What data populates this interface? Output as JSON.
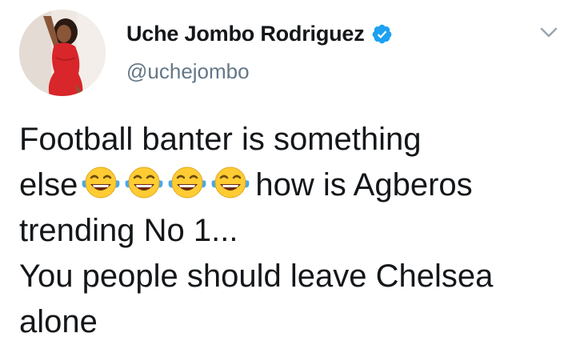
{
  "author": {
    "display_name": "Uche Jombo Rodriguez",
    "handle": "@uchejombo",
    "verified": true
  },
  "tweet": {
    "line1": "Football banter is something",
    "line2_before": "else",
    "line2_after": "how is Agberos",
    "line3": "trending No 1...",
    "line4": "You people should leave Chelsea",
    "line5": "alone",
    "emojis": [
      "face-with-tears-of-joy-icon",
      "face-with-tears-of-joy-icon",
      "face-with-tears-of-joy-icon",
      "face-with-tears-of-joy-icon"
    ]
  },
  "colors": {
    "verified_blue": "#1da1f2",
    "handle_gray": "#657786",
    "text": "#14171a",
    "emoji_yellow": "#ffcc33",
    "tear_blue": "#4aa8e8"
  }
}
